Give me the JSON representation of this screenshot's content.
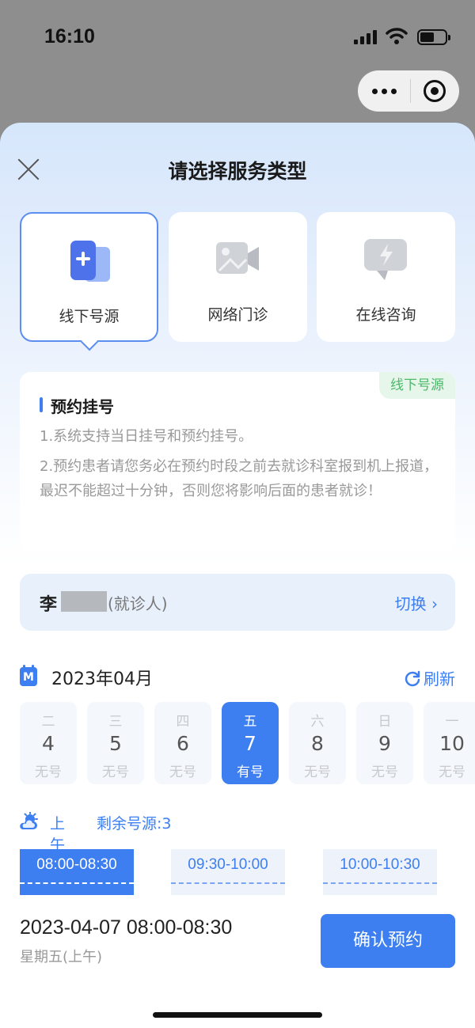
{
  "status_bar": {
    "time": "16:10"
  },
  "sheet": {
    "title": "请选择服务类型",
    "service_types": [
      {
        "label": "线下号源",
        "icon": "hospital-card-icon",
        "selected": true
      },
      {
        "label": "网络门诊",
        "icon": "video-icon",
        "selected": false
      },
      {
        "label": "在线咨询",
        "icon": "chat-bolt-icon",
        "selected": false
      }
    ]
  },
  "notice": {
    "tag": "线下号源",
    "title": "预约挂号",
    "items": [
      "1.系统支持当日挂号和预约挂号。",
      "2.预约患者请您务必在预约时段之前去就诊科室报到机上报道，最迟不能超过十分钟，否则您将影响后面的患者就诊！"
    ]
  },
  "patient": {
    "name": "李",
    "role": "(就诊人)",
    "switch_label": "切换 ›"
  },
  "calendar": {
    "month": "2023年04月",
    "icon_label": "M",
    "refresh_label": "刷新",
    "days": [
      {
        "weekday": "二",
        "date": "4",
        "status": "无号",
        "selected": false
      },
      {
        "weekday": "三",
        "date": "5",
        "status": "无号",
        "selected": false
      },
      {
        "weekday": "四",
        "date": "6",
        "status": "无号",
        "selected": false
      },
      {
        "weekday": "五",
        "date": "7",
        "status": "有号",
        "selected": true
      },
      {
        "weekday": "六",
        "date": "8",
        "status": "无号",
        "selected": false
      },
      {
        "weekday": "日",
        "date": "9",
        "status": "无号",
        "selected": false
      },
      {
        "weekday": "一",
        "date": "10",
        "status": "无号",
        "selected": false
      }
    ]
  },
  "session": {
    "label": "上午",
    "remaining": "剩余号源:3",
    "slots": [
      {
        "time": "08:00-08:30",
        "selected": true
      },
      {
        "time": "09:30-10:00",
        "selected": false
      },
      {
        "time": "10:00-10:30",
        "selected": false
      }
    ]
  },
  "selection": {
    "datetime": "2023-04-07 08:00-08:30",
    "weekday": "星期五(上午)",
    "confirm_label": "确认预约"
  },
  "colors": {
    "accent": "#3d7ef0",
    "tag_green": "#4cb86a",
    "muted": "#999999"
  }
}
